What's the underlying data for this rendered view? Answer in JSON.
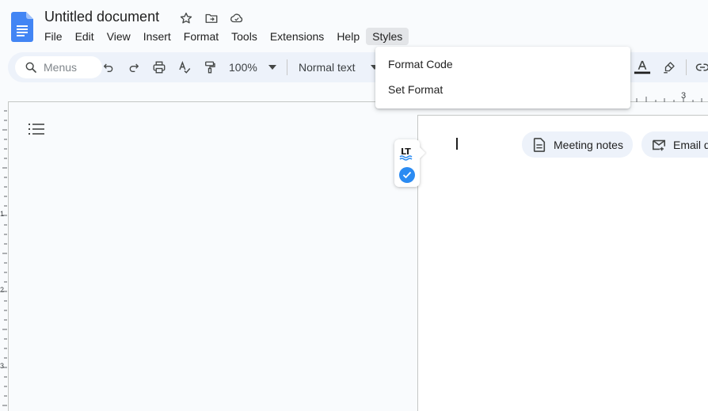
{
  "document": {
    "title": "Untitled document"
  },
  "menubar": {
    "items": [
      "File",
      "Edit",
      "View",
      "Insert",
      "Format",
      "Tools",
      "Extensions",
      "Help",
      "Styles"
    ],
    "active": "Styles"
  },
  "toolbar": {
    "search_placeholder": "Menus",
    "zoom": "100%",
    "paragraph_style": "Normal text"
  },
  "styles_menu": {
    "items": [
      "Format Code",
      "Set Format"
    ]
  },
  "ruler": {
    "top_label": "3",
    "left_labels": [
      "1",
      "2",
      "3"
    ]
  },
  "chips": {
    "meeting_notes": "Meeting notes",
    "email_draft": "Email d"
  },
  "icons": {
    "logo": "google-docs-icon",
    "star": "star-icon",
    "move": "move-to-folder-icon",
    "cloud": "cloud-saved-icon",
    "search": "search-icon",
    "undo": "undo-icon",
    "redo": "redo-icon",
    "print": "print-icon",
    "spellcheck": "spellcheck-icon",
    "paint_format": "paint-format-icon",
    "text_color": "text-color-icon",
    "highlight": "highlight-icon",
    "link": "link-icon",
    "outline": "outline-icon",
    "languagetool": "languagetool-icon",
    "check": "check-icon"
  },
  "colors": {
    "accent_blue": "#4285f4",
    "toolbar_bg": "#edf2fa",
    "check_blue": "#2b8bf2"
  }
}
